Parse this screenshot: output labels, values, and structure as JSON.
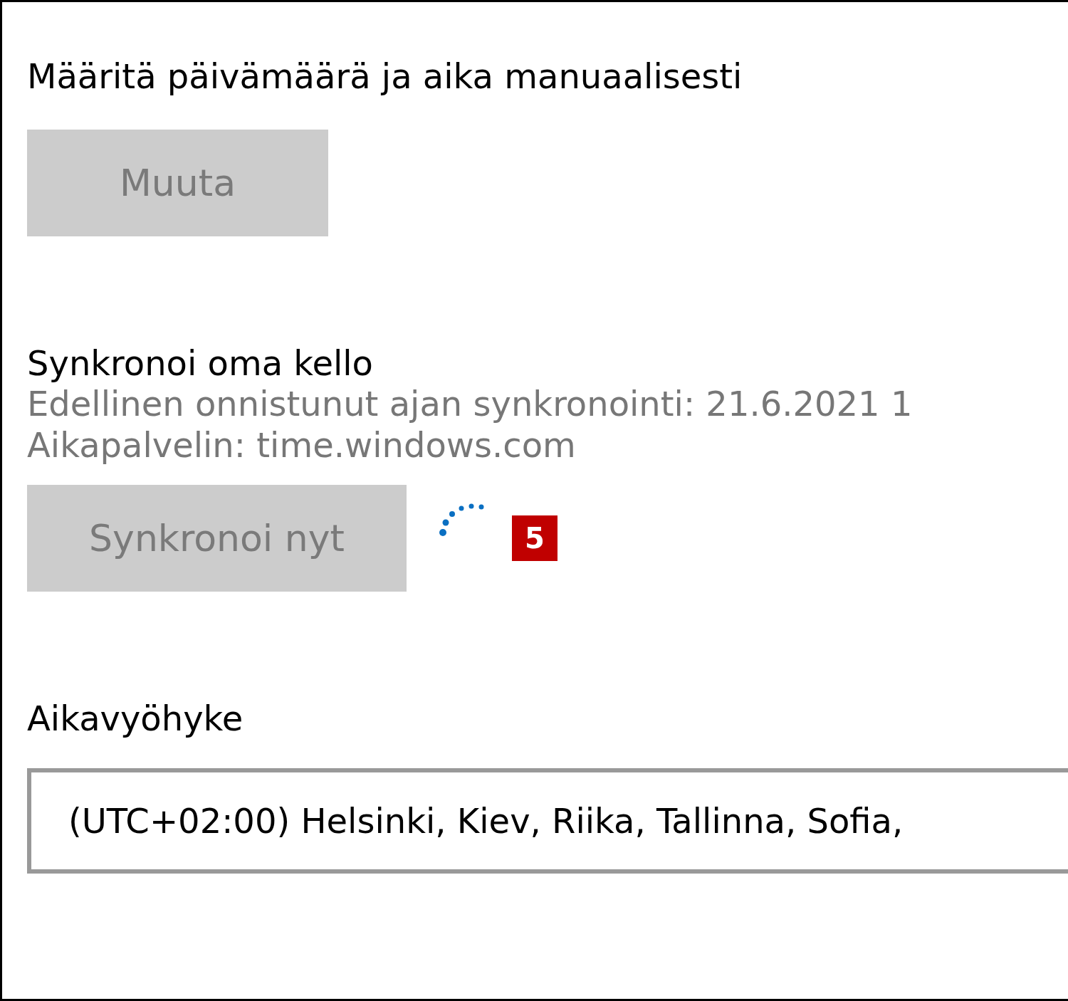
{
  "manual": {
    "label": "Määritä päivämäärä ja aika manuaalisesti",
    "button": {
      "label": "Muuta",
      "disabled": true
    }
  },
  "sync": {
    "title": "Synkronoi oma kello",
    "lines": [
      "Edellinen onnistunut ajan synkronointi: 21.6.2021 1",
      "Aikapalvelin: time.windows.com"
    ],
    "button": {
      "label": "Synkronoi nyt",
      "disabled": true
    },
    "busy": true,
    "badge": "5"
  },
  "timezone": {
    "label": "Aikavyöhyke",
    "value": "(UTC+02:00) Helsinki, Kiev, Riika, Tallinna, Sofia,"
  }
}
